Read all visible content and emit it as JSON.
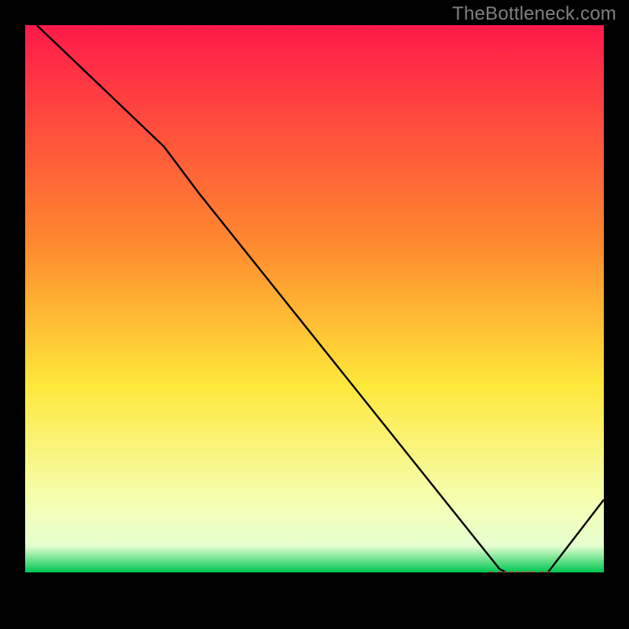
{
  "watermark": "TheBottleneck.com",
  "colors": {
    "bg": "#000000",
    "watermark": "#808080",
    "line": "#000000",
    "marker_fill": "#e86a6a",
    "marker_stroke": "#b83a38",
    "grad_top": "#ff1a4a",
    "grad_mid_upper": "#ff8a2e",
    "grad_mid": "#ffe73a",
    "grad_lower": "#f5ffb0",
    "grad_band": "#e6ffcf",
    "grad_green": "#00c853"
  },
  "chart_data": {
    "type": "line",
    "title": "",
    "xlabel": "",
    "ylabel": "",
    "xlim": [
      0,
      100
    ],
    "ylim": [
      0,
      100
    ],
    "gradient_stops": [
      {
        "pct": 0,
        "color": "#ff1a4a"
      },
      {
        "pct": 38,
        "color": "#ff8a2e"
      },
      {
        "pct": 62,
        "color": "#ffe73a"
      },
      {
        "pct": 82,
        "color": "#f5ffb0"
      },
      {
        "pct": 90,
        "color": "#e6ffcf"
      },
      {
        "pct": 94.5,
        "color": "#00c853"
      }
    ],
    "black_band_y_from": 94.5,
    "black_band_y_to": 100,
    "line_points": [
      {
        "x": 2,
        "y": 100
      },
      {
        "x": 24,
        "y": 79
      },
      {
        "x": 30,
        "y": 71
      },
      {
        "x": 82,
        "y": 6
      },
      {
        "x": 84,
        "y": 5
      },
      {
        "x": 90,
        "y": 5
      },
      {
        "x": 100,
        "y": 18
      }
    ],
    "markers": [
      {
        "x": 80.5,
        "y": 5
      },
      {
        "x": 82,
        "y": 5
      },
      {
        "x": 83,
        "y": 5
      },
      {
        "x": 84,
        "y": 5
      },
      {
        "x": 85,
        "y": 5
      },
      {
        "x": 86,
        "y": 5
      },
      {
        "x": 87,
        "y": 5
      },
      {
        "x": 87.8,
        "y": 5
      },
      {
        "x": 89.3,
        "y": 5
      },
      {
        "x": 90.4,
        "y": 5
      }
    ],
    "marker_radius": 4.2
  }
}
